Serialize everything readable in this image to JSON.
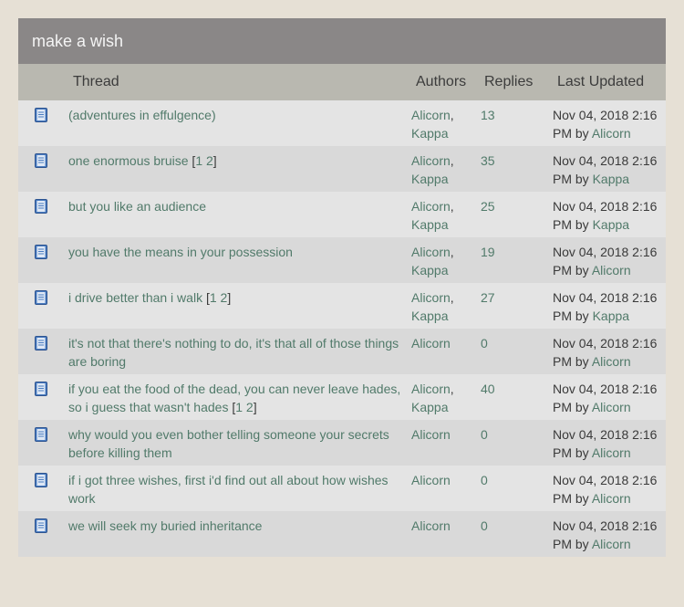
{
  "board": {
    "title": "make a wish",
    "headers": {
      "thread": "Thread",
      "authors": "Authors",
      "replies": "Replies",
      "last_updated": "Last Updated"
    }
  },
  "threads": [
    {
      "title": "(adventures in effulgence)",
      "pages": [],
      "authors": [
        "Alicorn",
        "Kappa"
      ],
      "replies": "13",
      "updated": "Nov 04, 2018 2:16 PM",
      "by": "by",
      "updated_by": "Alicorn"
    },
    {
      "title": "one enormous bruise",
      "pages": [
        "1",
        "2"
      ],
      "authors": [
        "Alicorn",
        "Kappa"
      ],
      "replies": "35",
      "updated": "Nov 04, 2018 2:16 PM",
      "by": "by",
      "updated_by": "Kappa"
    },
    {
      "title": "but you like an audience",
      "pages": [],
      "authors": [
        "Alicorn",
        "Kappa"
      ],
      "replies": "25",
      "updated": "Nov 04, 2018 2:16 PM",
      "by": "by",
      "updated_by": "Kappa"
    },
    {
      "title": "you have the means in your possession",
      "pages": [],
      "authors": [
        "Alicorn",
        "Kappa"
      ],
      "replies": "19",
      "updated": "Nov 04, 2018 2:16 PM",
      "by": "by",
      "updated_by": "Alicorn"
    },
    {
      "title": "i drive better than i walk",
      "pages": [
        "1",
        "2"
      ],
      "authors": [
        "Alicorn",
        "Kappa"
      ],
      "replies": "27",
      "updated": "Nov 04, 2018 2:16 PM",
      "by": "by",
      "updated_by": "Kappa"
    },
    {
      "title": "it's not that there's nothing to do, it's that all of those things are boring",
      "pages": [],
      "authors": [
        "Alicorn"
      ],
      "replies": "0",
      "updated": "Nov 04, 2018 2:16 PM",
      "by": "by",
      "updated_by": "Alicorn"
    },
    {
      "title": "if you eat the food of the dead, you can never leave hades, so i guess that wasn't hades",
      "pages": [
        "1",
        "2"
      ],
      "authors": [
        "Alicorn",
        "Kappa"
      ],
      "replies": "40",
      "updated": "Nov 04, 2018 2:16 PM",
      "by": "by",
      "updated_by": "Alicorn"
    },
    {
      "title": "why would you even bother telling someone your secrets before killing them",
      "pages": [],
      "authors": [
        "Alicorn"
      ],
      "replies": "0",
      "updated": "Nov 04, 2018 2:16 PM",
      "by": "by",
      "updated_by": "Alicorn"
    },
    {
      "title": "if i got three wishes, first i'd find out all about how wishes work",
      "pages": [],
      "authors": [
        "Alicorn"
      ],
      "replies": "0",
      "updated": "Nov 04, 2018 2:16 PM",
      "by": "by",
      "updated_by": "Alicorn"
    },
    {
      "title": "we will seek my buried inheritance",
      "pages": [],
      "authors": [
        "Alicorn"
      ],
      "replies": "0",
      "updated": "Nov 04, 2018 2:16 PM",
      "by": "by",
      "updated_by": "Alicorn"
    }
  ],
  "colors": {
    "link": "#517a6a",
    "title_bar": "#8a8787",
    "header_bar": "#b9b8b0",
    "row_odd": "#e4e4e4",
    "row_even": "#d9d9d9",
    "page_bg": "#e6e0d5"
  },
  "icons": {
    "thread": "book-icon"
  }
}
